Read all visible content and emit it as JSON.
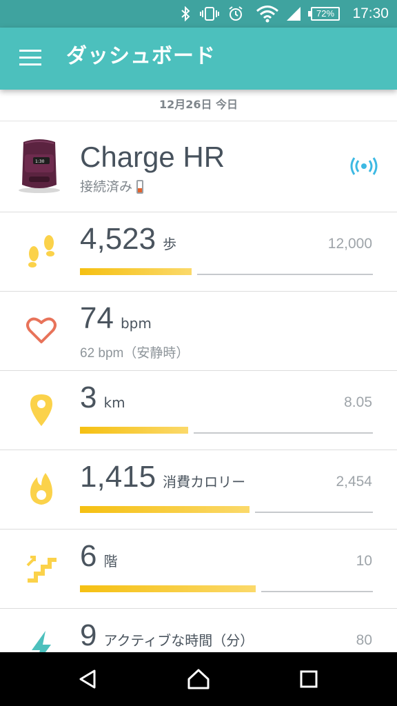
{
  "status_bar": {
    "time": "17:30",
    "battery_percent": "72%",
    "icons": [
      "bluetooth-icon",
      "vibrate-icon",
      "alarm-icon",
      "wifi-icon",
      "signal-icon",
      "battery-icon"
    ]
  },
  "app_bar": {
    "title": "ダッシュボード",
    "menu_icon": "hamburger-menu-icon"
  },
  "date_header": "12月26日 今日",
  "device": {
    "name": "Charge HR",
    "status": "接続済み",
    "battery_level": "low",
    "sync_icon": "sync-signal-icon"
  },
  "stats": [
    {
      "key": "steps",
      "value": "4,523",
      "unit": "歩",
      "goal": "12,000",
      "progress": 0.38,
      "icon": "footsteps-icon"
    },
    {
      "key": "heart_rate",
      "value": "74",
      "unit": "bpm",
      "sub": "62 bpm（安静時）",
      "icon": "heart-icon"
    },
    {
      "key": "distance",
      "value": "3",
      "unit": "km",
      "goal": "8.05",
      "progress": 0.37,
      "icon": "location-pin-icon"
    },
    {
      "key": "calories",
      "value": "1,415",
      "unit": "消費カロリー",
      "goal": "2,454",
      "progress": 0.58,
      "icon": "flame-icon"
    },
    {
      "key": "floors",
      "value": "6",
      "unit": "階",
      "goal": "10",
      "progress": 0.6,
      "icon": "stairs-icon"
    },
    {
      "key": "active_minutes",
      "value": "9",
      "unit": "アクティブな時間（分）",
      "goal": "80",
      "icon": "lightning-icon"
    }
  ],
  "nav_bar": [
    "back-icon",
    "home-icon",
    "recents-icon"
  ],
  "colors": {
    "status_bar": "#3fa39f",
    "app_bar": "#4cc0bd",
    "progress": "#f5c012",
    "heart": "#e8735a",
    "sync": "#3db9e3"
  }
}
